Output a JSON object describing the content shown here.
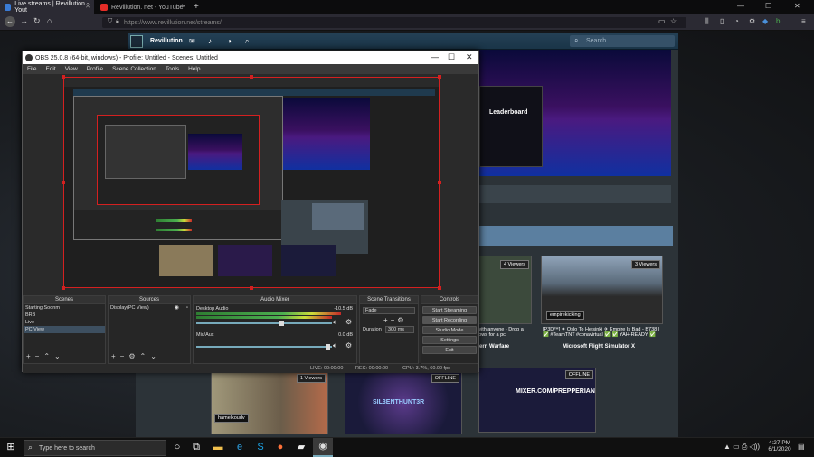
{
  "browser": {
    "tabs": [
      {
        "label": "Live streams | Revillution - Yout"
      },
      {
        "label": "Revillution. net - YouTube"
      }
    ],
    "new_tab": "+",
    "url": "https://www.revillution.net/streams/",
    "window_controls": {
      "minimize": "—",
      "maximize": "☐",
      "close": "✕"
    }
  },
  "site": {
    "name": "Revillution",
    "search_placeholder": "Search...",
    "leaderboard": "Leaderboard",
    "stream_cards": [
      {
        "viewers": "4 Viewers",
        "caption": "ern Warfare",
        "sub": "with anyone - Drop a\nlows for a pc!"
      },
      {
        "viewers": "3 Viewers",
        "caption": "Microsoft Flight Simulator X",
        "sub": "[P3D™] ✈ Oslo To Helsinki ✈ Empire Is Bad - B738 |\n✅ #TeamTNT #conavirtual ✅ ✅ YAH-READY ✅",
        "user": "empirekicking"
      },
      {
        "viewers": "1 Viewers",
        "user": "hamelkoudv"
      },
      {
        "status": "OFFLINE",
        "logo": "SIL3ENTHUNT3R"
      },
      {
        "status": "OFFLINE",
        "logo": "MIXER.COM/PREPPERIAN"
      }
    ]
  },
  "obs": {
    "title": "OBS 25.0.8 (64-bit, windows) - Profile: Untitled - Scenes: Untitled",
    "menu": [
      "File",
      "Edit",
      "View",
      "Profile",
      "Scene Collection",
      "Tools",
      "Help"
    ],
    "docks": {
      "scenes": {
        "title": "Scenes",
        "items": [
          "Starting Soonm",
          "BRB",
          "Live",
          "PC View"
        ]
      },
      "sources": {
        "title": "Sources",
        "items": [
          "Display(PC View)"
        ]
      },
      "mixer": {
        "title": "Audio Mixer",
        "channels": [
          {
            "name": "Desktop Audio",
            "db": "-10.5 dB"
          },
          {
            "name": "Mic/Aux",
            "db": "0.0 dB"
          }
        ]
      },
      "transitions": {
        "title": "Scene Transitions",
        "type": "Fade",
        "duration_label": "Duration",
        "duration_value": "300 ms"
      },
      "controls": {
        "title": "Controls",
        "buttons": [
          "Start Streaming",
          "Start Recording",
          "Studio Mode",
          "Settings",
          "Exit"
        ]
      }
    },
    "status": {
      "live": "LIVE: 00:00:00",
      "rec": "REC: 00:00:00",
      "cpu": "CPU: 3.7%, 60.00 fps"
    }
  },
  "taskbar": {
    "search_placeholder": "Type here to search",
    "time": "4:27 PM",
    "date": "6/1/2020"
  },
  "colors": {
    "preview_border": "#d42020",
    "site_header": "#244055",
    "accent_green": "#4caf50"
  }
}
